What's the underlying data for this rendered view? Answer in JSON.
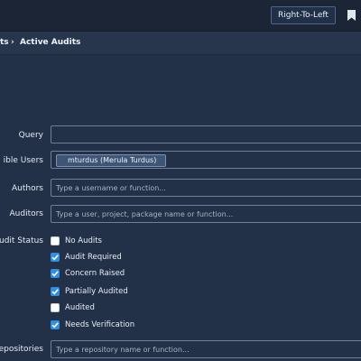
{
  "toolbar": {
    "rtl_button": "Right-To-Left"
  },
  "breadcrumb": {
    "first": "ts",
    "separator": "›",
    "current": "Active Audits"
  },
  "form": {
    "query": {
      "label": "Query",
      "value": ""
    },
    "visible_users": {
      "label": "ible Users",
      "chip": "mturdus (Merula Turdus)"
    },
    "authors": {
      "label": "Authors",
      "placeholder": "Type a username or function..."
    },
    "auditors": {
      "label": "Auditors",
      "placeholder": "Type a user, project, package name or function..."
    },
    "audit_status": {
      "label": "udit Status",
      "options": [
        {
          "label": "No Audits",
          "checked": false
        },
        {
          "label": "Audit Required",
          "checked": true
        },
        {
          "label": "Concern Raised",
          "checked": true
        },
        {
          "label": "Partially Audited",
          "checked": true
        },
        {
          "label": "Audited",
          "checked": false
        },
        {
          "label": "Needs Verification",
          "checked": true
        }
      ]
    },
    "repositories": {
      "label": "Repositories",
      "placeholder": "Type a repository name or function..."
    }
  },
  "colors": {
    "background": "#233148",
    "topbar": "#1b2536",
    "checkbox_checked": "#2f8fe0"
  }
}
